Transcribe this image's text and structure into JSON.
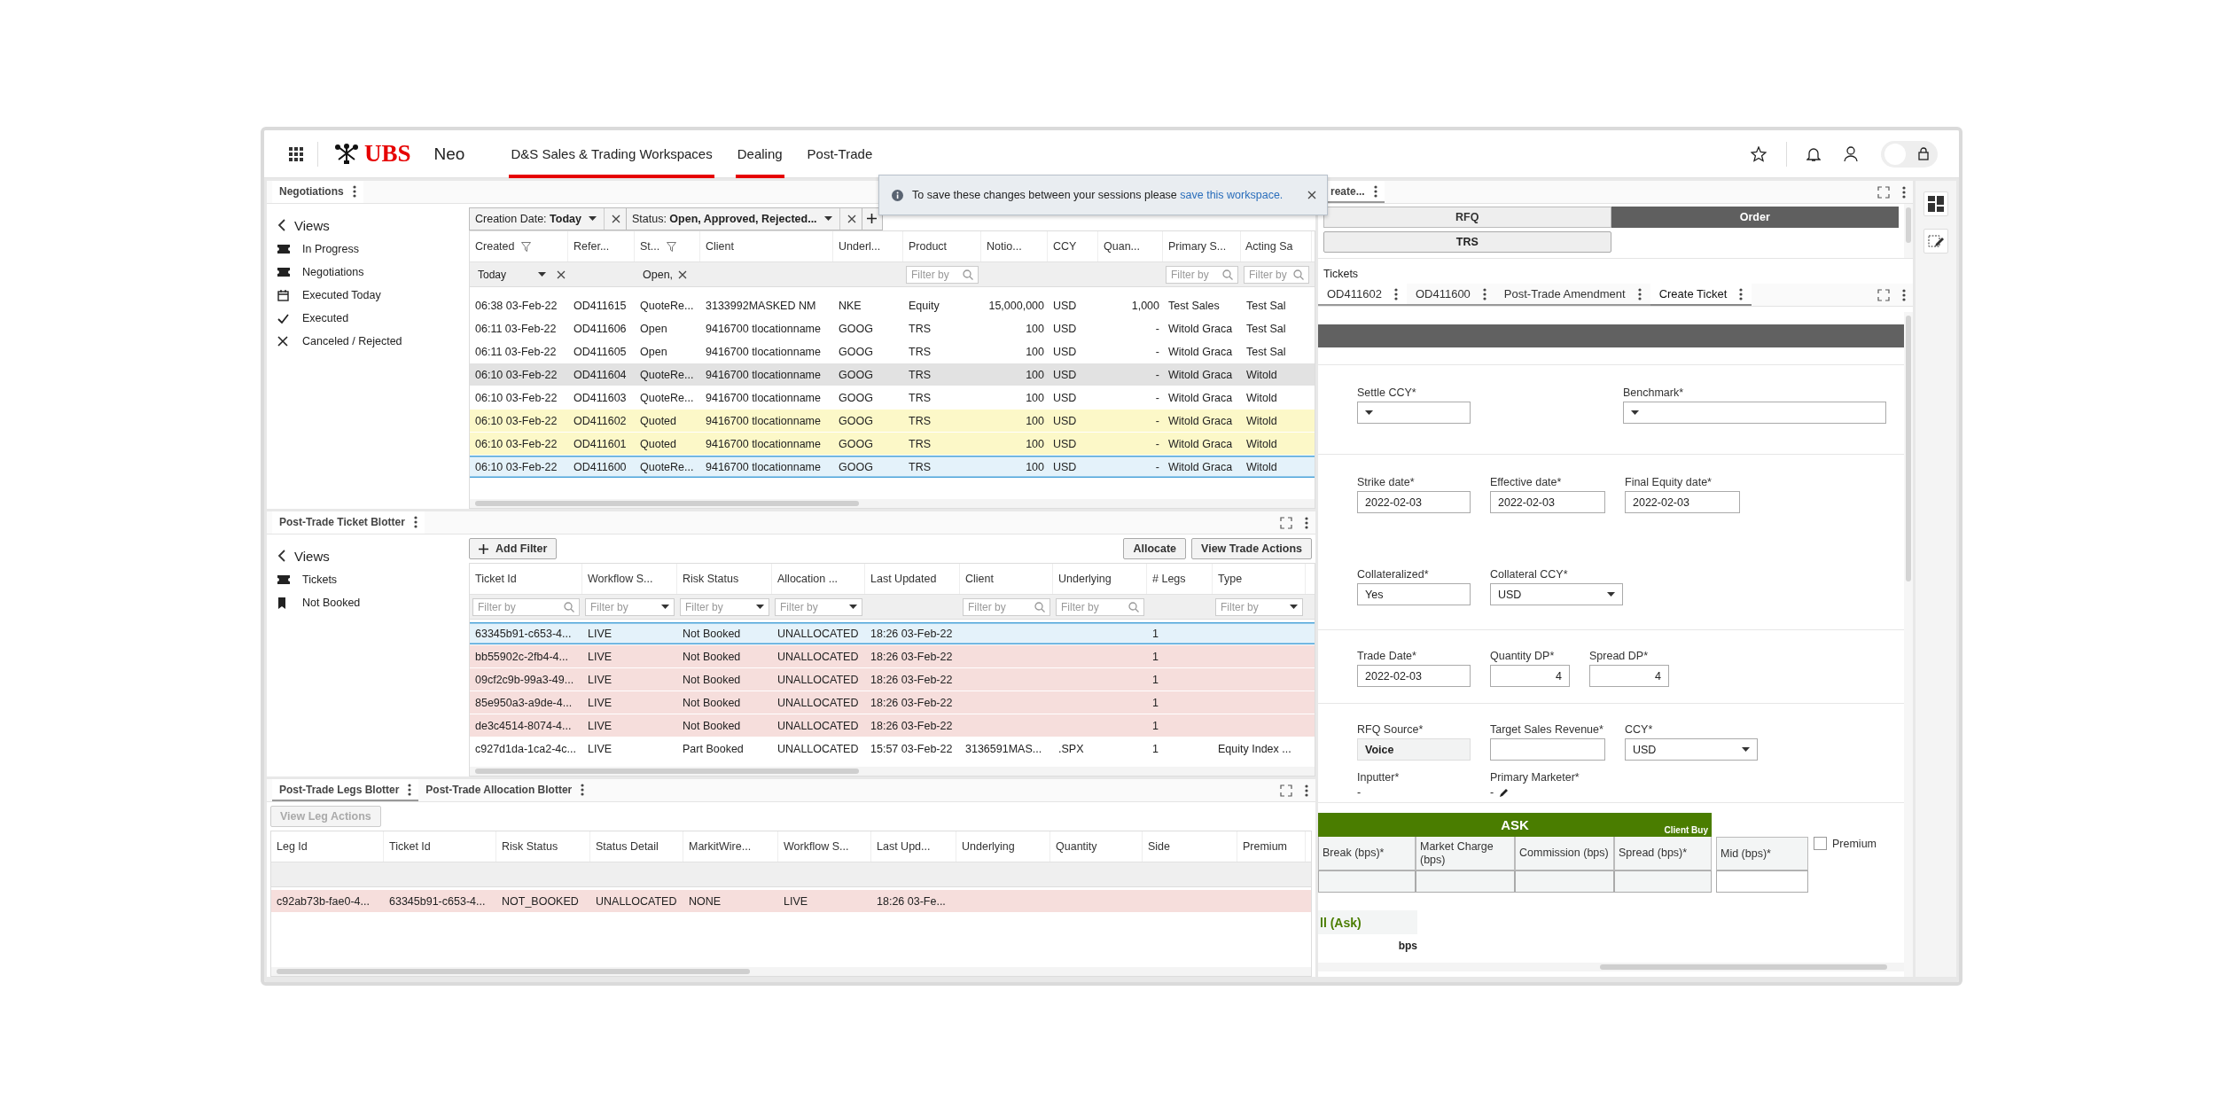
{
  "top_bar": {
    "logo": "UBS",
    "app_name": "Neo",
    "nav": [
      {
        "label": "D&S Sales & Trading Workspaces",
        "selected": true
      },
      {
        "label": "Dealing",
        "selected": true
      },
      {
        "label": "Post-Trade",
        "selected": false
      }
    ],
    "lock_toggle": {
      "on": false
    }
  },
  "toast": {
    "text": "To save these changes between your sessions please ",
    "link": "save this workspace."
  },
  "negotiations": {
    "tab": "Negotiations",
    "views_title": "Views",
    "views": [
      {
        "label": "In Progress",
        "kind": "ticket"
      },
      {
        "label": "Negotiations",
        "kind": "ticket"
      },
      {
        "label": "Executed Today",
        "kind": "calendar"
      },
      {
        "label": "Executed",
        "kind": "check"
      },
      {
        "label": "Canceled / Rejected",
        "kind": "cross"
      }
    ],
    "chips": [
      "Creation Date: **Today**",
      "Status: **Open, Approved, Rejected...**"
    ],
    "columns": [
      {
        "label": "Created",
        "filtered": true
      },
      {
        "label": "Refer...",
        "filtered": false
      },
      {
        "label": "St...",
        "filtered": true
      },
      {
        "label": "Client",
        "filtered": false
      },
      {
        "label": "Underl...",
        "filtered": false
      },
      {
        "label": "Product",
        "filtered": false
      },
      {
        "label": "Notio...",
        "filtered": false
      },
      {
        "label": "CCY",
        "filtered": false
      },
      {
        "label": "Quan...",
        "filtered": false
      },
      {
        "label": "Primary S...",
        "filtered": false
      },
      {
        "label": "Acting Sa",
        "filtered": false
      }
    ],
    "filters": [
      {
        "kind": "select",
        "value": "Today",
        "clearable": true
      },
      {
        "kind": "none"
      },
      {
        "kind": "text",
        "value": "Open,",
        "clearable": true
      },
      {
        "kind": "none"
      },
      {
        "kind": "none"
      },
      {
        "kind": "search",
        "placeholder": "Filter by"
      },
      {
        "kind": "none"
      },
      {
        "kind": "none"
      },
      {
        "kind": "none"
      },
      {
        "kind": "search",
        "placeholder": "Filter by"
      },
      {
        "kind": "search",
        "placeholder": "Filter by"
      }
    ],
    "rows": [
      {
        "selected": false,
        "kind": "plain",
        "cells": [
          "06:38 03-Feb-22",
          "OD411615",
          "QuoteRe...",
          "3133992MASKED NM",
          "NKE",
          "Equity",
          "15,000,000",
          "USD",
          "1,000",
          "Test Sales",
          "Test Sal"
        ]
      },
      {
        "selected": false,
        "kind": "plain",
        "cells": [
          "06:11 03-Feb-22",
          "OD411606",
          "Open",
          "9416700 tlocationname",
          "GOOG",
          "TRS",
          "100",
          "USD",
          "-",
          "Witold Graca",
          "Test Sal"
        ]
      },
      {
        "selected": false,
        "kind": "plain",
        "cells": [
          "06:11 03-Feb-22",
          "OD411605",
          "Open",
          "9416700 tlocationname",
          "GOOG",
          "TRS",
          "100",
          "USD",
          "-",
          "Witold Graca",
          "Test Sal"
        ]
      },
      {
        "selected": false,
        "kind": "shaded",
        "cells": [
          "06:10 03-Feb-22",
          "OD411604",
          "QuoteRe...",
          "9416700 tlocationname",
          "GOOG",
          "TRS",
          "100",
          "USD",
          "-",
          "Witold Graca",
          "Witold"
        ]
      },
      {
        "selected": false,
        "kind": "plain",
        "cells": [
          "06:10 03-Feb-22",
          "OD411603",
          "QuoteRe...",
          "9416700 tlocationname",
          "GOOG",
          "TRS",
          "100",
          "USD",
          "-",
          "Witold Graca",
          "Witold"
        ]
      },
      {
        "selected": false,
        "kind": "pending",
        "cells": [
          "06:10 03-Feb-22",
          "OD411602",
          "Quoted",
          "9416700 tlocationname",
          "GOOG",
          "TRS",
          "100",
          "USD",
          "-",
          "Witold Graca",
          "Witold"
        ]
      },
      {
        "selected": false,
        "kind": "pending",
        "cells": [
          "06:10 03-Feb-22",
          "OD411601",
          "Quoted",
          "9416700 tlocationname",
          "GOOG",
          "TRS",
          "100",
          "USD",
          "-",
          "Witold Graca",
          "Witold"
        ]
      },
      {
        "selected": true,
        "kind": "focus",
        "cells": [
          "06:10 03-Feb-22",
          "OD411600",
          "QuoteRe...",
          "9416700 tlocationname",
          "GOOG",
          "TRS",
          "100",
          "USD",
          "-",
          "Witold Graca",
          "Witold"
        ]
      }
    ]
  },
  "ticket_blotter": {
    "tab": "Post-Trade Ticket Blotter",
    "views_title": "Views",
    "views": [
      {
        "label": "Tickets",
        "kind": "ticket"
      },
      {
        "label": "Not Booked",
        "kind": "bookmark"
      }
    ],
    "add_filter": "Add Filter",
    "actions": [
      "Allocate",
      "View Trade Actions"
    ],
    "columns": [
      {
        "label": "Ticket Id"
      },
      {
        "label": "Workflow S..."
      },
      {
        "label": "Risk Status"
      },
      {
        "label": "Allocation ..."
      },
      {
        "label": "Last Updated"
      },
      {
        "label": "Client"
      },
      {
        "label": "Underlying"
      },
      {
        "label": "# Legs"
      },
      {
        "label": "Type"
      }
    ],
    "filters": [
      {
        "kind": "search",
        "placeholder": "Filter by"
      },
      {
        "kind": "select",
        "placeholder": "Filter by"
      },
      {
        "kind": "select",
        "placeholder": "Filter by"
      },
      {
        "kind": "select",
        "placeholder": "Filter by"
      },
      {
        "kind": "none"
      },
      {
        "kind": "search",
        "placeholder": "Filter by"
      },
      {
        "kind": "search",
        "placeholder": "Filter by"
      },
      {
        "kind": "none"
      },
      {
        "kind": "select",
        "placeholder": "Filter by"
      }
    ],
    "rows": [
      {
        "selected": true,
        "kind": "focus",
        "cells": [
          "63345b91-c653-4...",
          "LIVE",
          "Not Booked",
          "UNALLOCATED",
          "18:26 03-Feb-22",
          null,
          null,
          "1",
          null
        ]
      },
      {
        "selected": false,
        "kind": "alert",
        "cells": [
          "bb55902c-2fb4-4...",
          "LIVE",
          "Not Booked",
          "UNALLOCATED",
          "18:26 03-Feb-22",
          null,
          null,
          "1",
          null
        ]
      },
      {
        "selected": false,
        "kind": "alert",
        "cells": [
          "09cf2c9b-99a3-49...",
          "LIVE",
          "Not Booked",
          "UNALLOCATED",
          "18:26 03-Feb-22",
          null,
          null,
          "1",
          null
        ]
      },
      {
        "selected": false,
        "kind": "alert",
        "cells": [
          "85e950a3-a9de-4...",
          "LIVE",
          "Not Booked",
          "UNALLOCATED",
          "18:26 03-Feb-22",
          null,
          null,
          "1",
          null
        ]
      },
      {
        "selected": false,
        "kind": "alert",
        "cells": [
          "de3c4514-8074-4...",
          "LIVE",
          "Not Booked",
          "UNALLOCATED",
          "18:26 03-Feb-22",
          null,
          null,
          "1",
          null
        ]
      },
      {
        "selected": false,
        "kind": "plain",
        "cells": [
          "c927d1da-1ca2-4c...",
          "LIVE",
          "Part Booked",
          "UNALLOCATED",
          "15:57 03-Feb-22",
          "3136591MAS...",
          ".SPX",
          "1",
          "Equity Index ..."
        ]
      }
    ]
  },
  "legs_blotter": {
    "tabs": [
      {
        "label": "Post-Trade Legs Blotter",
        "selected": true
      },
      {
        "label": "Post-Trade Allocation Blotter",
        "selected": false
      }
    ],
    "action": {
      "label": "View Leg Actions",
      "disabled": true
    },
    "columns": [
      {
        "label": "Leg Id"
      },
      {
        "label": "Ticket Id"
      },
      {
        "label": "Risk Status"
      },
      {
        "label": "Status Detail"
      },
      {
        "label": "MarkitWire..."
      },
      {
        "label": "Workflow S..."
      },
      {
        "label": "Last Upd..."
      },
      {
        "label": "Underlying"
      },
      {
        "label": "Quantity"
      },
      {
        "label": "Side"
      },
      {
        "label": "Premium"
      }
    ],
    "rows": [
      {
        "selected": false,
        "kind": "alert",
        "cells": [
          "c92ab73b-fae0-4...",
          "63345b91-c653-4...",
          "NOT_BOOKED",
          "UNALLOCATED",
          "NONE",
          "LIVE",
          "18:26 03-Fe...",
          null,
          null,
          null,
          null
        ]
      }
    ]
  },
  "ticket_panel": {
    "tab": "reate...",
    "modes": [
      {
        "label": "RFQ",
        "selected": false
      },
      {
        "label": "Order",
        "selected": true
      }
    ],
    "product": "TRS",
    "tickets_title": "Tickets",
    "ticket_tabs": [
      {
        "label": "OD411602",
        "selected": false
      },
      {
        "label": "OD411600",
        "selected": false
      },
      {
        "label": "Post-Trade Amendment",
        "selected": false
      },
      {
        "label": "Create Ticket",
        "selected": true
      }
    ],
    "sections": [
      {
        "rows": [
          [
            {
              "label": "Settle CCY*",
              "kind": "select"
            },
            {
              "label": "Benchmark*",
              "kind": "select"
            }
          ]
        ]
      },
      {
        "rows": [
          [
            {
              "label": "Strike date*",
              "kind": "input",
              "value": "2022-02-03"
            },
            {
              "label": "Effective date*",
              "kind": "input",
              "value": "2022-02-03"
            },
            {
              "label": "Final Equity date*",
              "kind": "input",
              "value": "2022-02-03"
            }
          ],
          [
            {
              "label": "Collateralized*",
              "kind": "input",
              "value": "Yes"
            },
            {
              "label": "Collateral CCY*",
              "kind": "select",
              "value": "USD"
            }
          ]
        ]
      },
      {
        "rows": [
          [
            {
              "label": "Trade Date*",
              "kind": "input",
              "value": "2022-02-03"
            },
            {
              "label": "Quantity DP*",
              "kind": "number",
              "value": "4"
            },
            {
              "label": "Spread DP*",
              "kind": "number",
              "value": "4"
            }
          ]
        ]
      },
      {
        "rows": [
          [
            {
              "label": "RFQ Source*",
              "kind": "readonly",
              "value": "Voice"
            },
            {
              "label": "Target Sales Revenue*",
              "kind": "input"
            },
            {
              "label": "CCY*",
              "kind": "select",
              "value": "USD"
            }
          ],
          [
            {
              "label": "Inputter*",
              "kind": "display",
              "value": "-",
              "editable": false
            },
            {
              "label": "Primary Marketer*",
              "kind": "display",
              "value": "-",
              "editable": true
            }
          ]
        ]
      }
    ],
    "ask": {
      "title": "ASK",
      "side": "Client Buy",
      "columns": [
        "Break (bps)*",
        "Market Charge (bps)",
        "Commission (bps)",
        "Spread (bps)*"
      ],
      "mid": "Mid (bps)*",
      "premium": {
        "label": "Premium",
        "checked": false
      }
    },
    "summary": {
      "title": "ll (Ask)",
      "unit": "bps"
    }
  }
}
